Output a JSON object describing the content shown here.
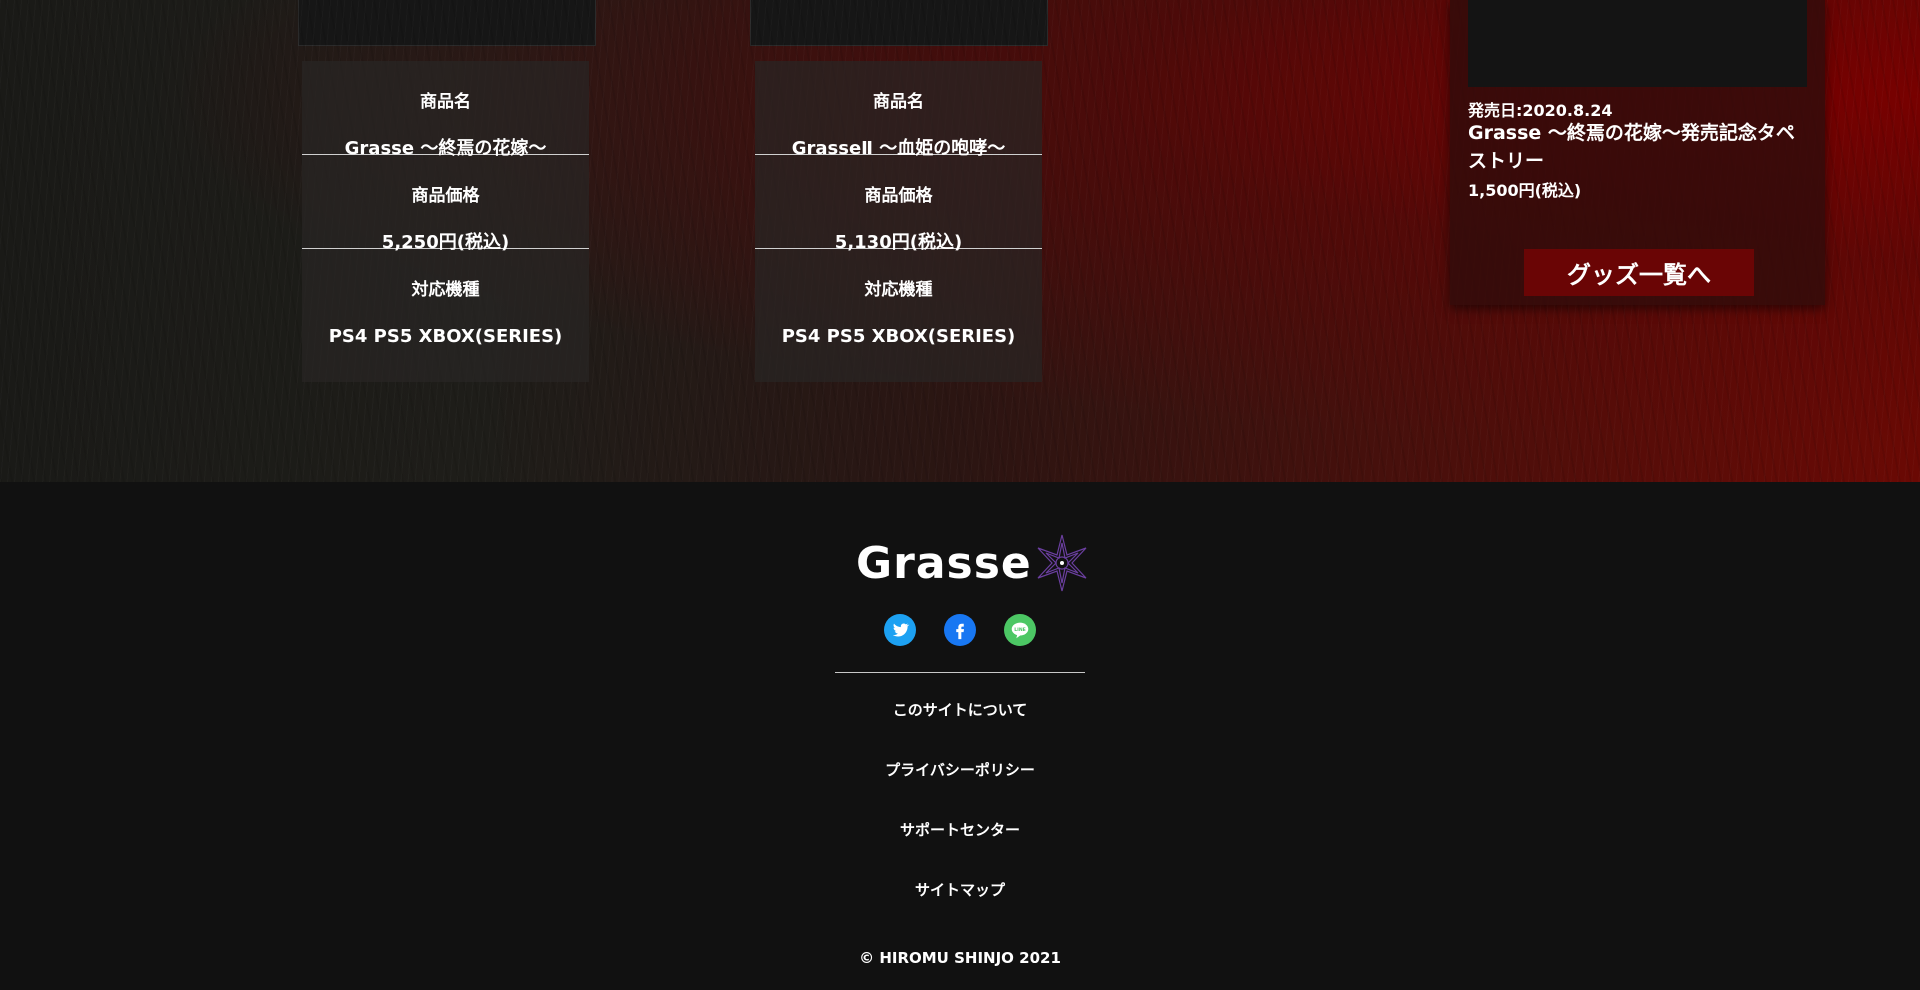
{
  "products": [
    {
      "name_label": "商品名",
      "name": "Grasse ～終焉の花嫁～",
      "price_label": "商品価格",
      "price": "5,250円(税込)",
      "platform_label": "対応機種",
      "platforms": "PS4 PS5 XBOX(SERIES)"
    },
    {
      "name_label": "商品名",
      "name": "GrasseⅡ ～血姫の咆哮～",
      "price_label": "商品価格",
      "price": "5,130円(税込)",
      "platform_label": "対応機種",
      "platforms": "PS4 PS5 XBOX(SERIES)"
    }
  ],
  "goods": {
    "date": "発売日:2020.8.24",
    "title": "Grasse ～終焉の花嫁～発売記念タペストリー",
    "price": "1,500円(税込)",
    "button_label": "グッズ一覧へ"
  },
  "footer": {
    "logo_text": "Grasse",
    "social": [
      {
        "icon": "twitter-icon",
        "color": "#1DA1F2"
      },
      {
        "icon": "facebook-icon",
        "color": "#1877F2"
      },
      {
        "icon": "line-icon",
        "color": "#4CC764"
      }
    ],
    "links": [
      "このサイトについて",
      "プライバシーポリシー",
      "サポートセンター",
      "サイトマップ"
    ],
    "copyright": "© HIROMU SHINJO 2021"
  },
  "colors": {
    "accent": "#6A0505",
    "footer_bg": "#111111",
    "logo_mark": "#6B3FA0"
  }
}
